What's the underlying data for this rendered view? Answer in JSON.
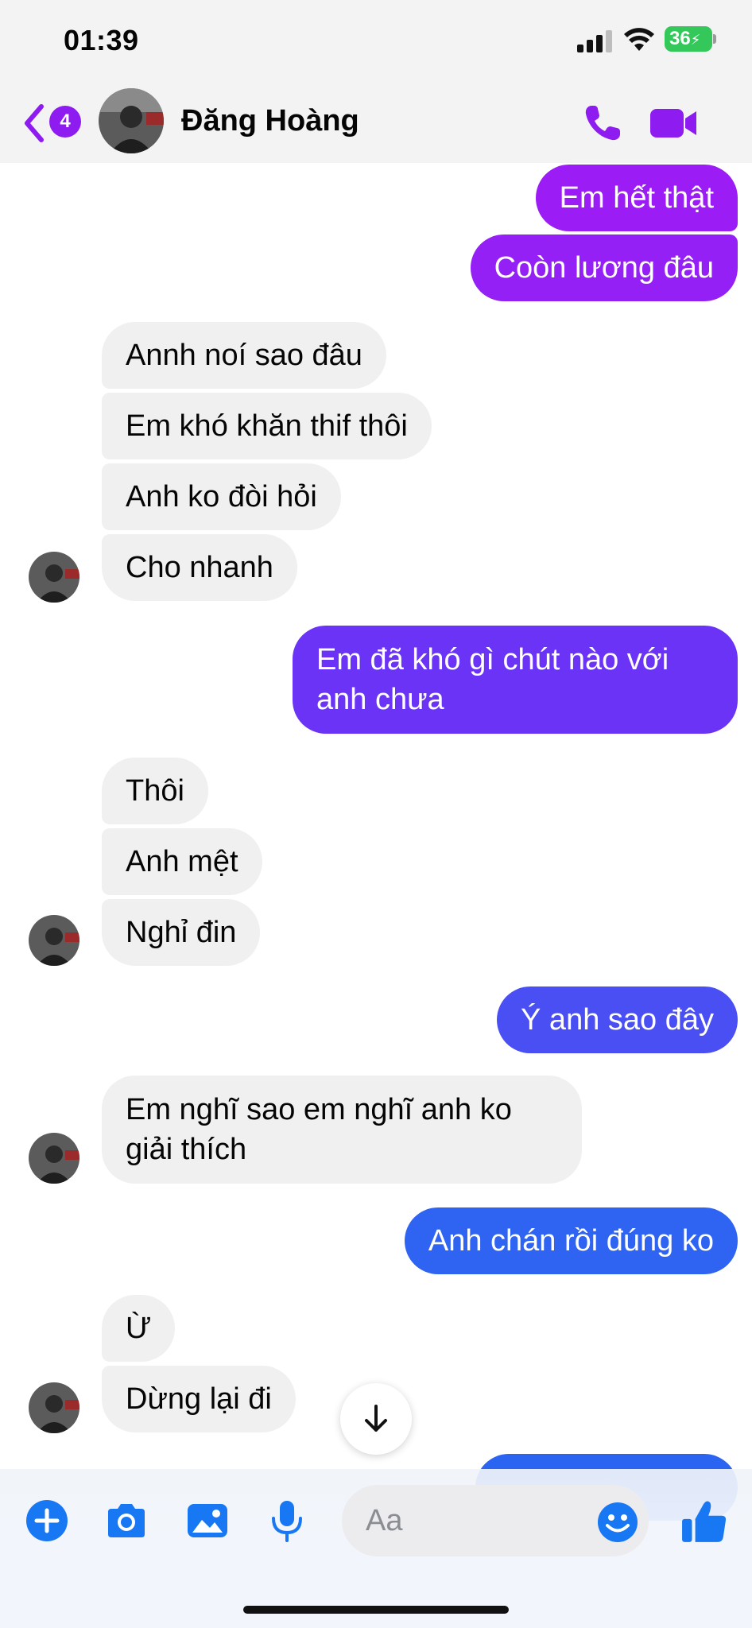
{
  "status_bar": {
    "time": "01:39",
    "battery": "36"
  },
  "header": {
    "unread_count": "4",
    "contact_name": "Đăng Hoàng"
  },
  "messages": [
    {
      "side": "out",
      "text": "Em hết thật"
    },
    {
      "side": "out",
      "text": "Coòn lương đâu"
    },
    {
      "side": "in",
      "text": "Annh noí sao đâu"
    },
    {
      "side": "in",
      "text": "Em khó khăn thif thôi"
    },
    {
      "side": "in",
      "text": "Anh ko đòi hỏi"
    },
    {
      "side": "in",
      "text": "Cho nhanh"
    },
    {
      "side": "out",
      "text": "Em đã khó gì chút nào với anh chưa"
    },
    {
      "side": "in",
      "text": "Thôi"
    },
    {
      "side": "in",
      "text": "Anh mệt"
    },
    {
      "side": "in",
      "text": "Nghỉ đin"
    },
    {
      "side": "out",
      "text": "Ý anh sao đây"
    },
    {
      "side": "in",
      "text": "Em nghĩ sao em nghĩ anh ko giải thích"
    },
    {
      "side": "out",
      "text": "Anh chán rồi đúng ko"
    },
    {
      "side": "in",
      "text": "Ừ"
    },
    {
      "side": "in",
      "text": "Dừng lại đi"
    }
  ],
  "composer": {
    "placeholder": "Aa"
  },
  "colors": {
    "accent_purple": "#8e1cf0",
    "outgoing_top": "#9b1cf5",
    "outgoing_mid": "#6a33f5",
    "outgoing_bottom": "#2f63f2",
    "incoming_bg": "#f0f0f0",
    "composer_blue": "#1877f2"
  },
  "icons": [
    "back-chevron-icon",
    "phone-icon",
    "video-camera-icon",
    "arrow-down-icon",
    "plus-icon",
    "camera-icon",
    "image-icon",
    "microphone-icon",
    "emoji-icon",
    "thumbs-up-icon"
  ]
}
